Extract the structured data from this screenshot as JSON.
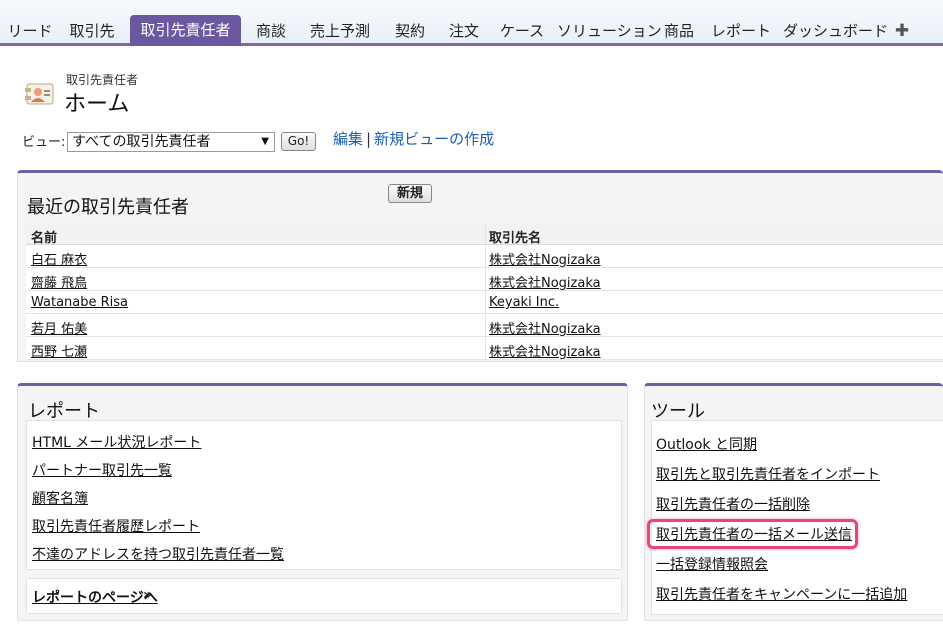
{
  "tabs": [
    {
      "label": "リード",
      "active": false
    },
    {
      "label": "取引先",
      "active": false
    },
    {
      "label": "取引先責任者",
      "active": true
    },
    {
      "label": "商談",
      "active": false
    },
    {
      "label": "売上予測",
      "active": false
    },
    {
      "label": "契約",
      "active": false
    },
    {
      "label": "注文",
      "active": false
    },
    {
      "label": "ケース",
      "active": false
    },
    {
      "label": "ソリューション",
      "active": false
    },
    {
      "label": "商品",
      "active": false
    },
    {
      "label": "レポート",
      "active": false
    },
    {
      "label": "ダッシュボード",
      "active": false
    }
  ],
  "tab_plus": "✚",
  "header": {
    "subtitle": "取引先責任者",
    "title": "ホーム",
    "icon": "contacts-card-icon"
  },
  "view": {
    "label": "ビュー:",
    "selected": "すべての取引先責任者",
    "go_label": "Go!",
    "edit_link": "編集",
    "separator": "|",
    "new_view_link": "新規ビューの作成"
  },
  "recent": {
    "title": "最近の取引先責任者",
    "new_button": "新規",
    "columns": [
      "名前",
      "取引先名"
    ],
    "rows": [
      {
        "name": "白石 麻衣",
        "account": "株式会社Nogizaka"
      },
      {
        "name": "齋藤 飛鳥",
        "account": "株式会社Nogizaka"
      },
      {
        "name": "Watanabe Risa",
        "account": "Keyaki Inc."
      },
      {
        "name": "若月 佑美",
        "account": "株式会社Nogizaka"
      },
      {
        "name": "西野 七瀬",
        "account": "株式会社Nogizaka"
      }
    ]
  },
  "reports": {
    "title": "レポート",
    "items": [
      "HTML メール状況レポート",
      "パートナー取引先一覧",
      "顧客名簿",
      "取引先責任者履歴レポート",
      "不達のアドレスを持つ取引先責任者一覧"
    ],
    "footer_link": "レポートのページへ",
    "footer_arrow": "»"
  },
  "tools": {
    "title": "ツール",
    "items": [
      "Outlook と同期",
      "取引先と取引先責任者をインポート",
      "取引先責任者の一括削除",
      "取引先責任者の一括メール送信",
      "一括登録情報照会",
      "取引先責任者をキャンペーンに一括追加"
    ],
    "highlighted_index": 3,
    "highlight_color": "#e8457a"
  },
  "colors": {
    "accent": "#6b58a0",
    "link": "#1a5db5"
  }
}
